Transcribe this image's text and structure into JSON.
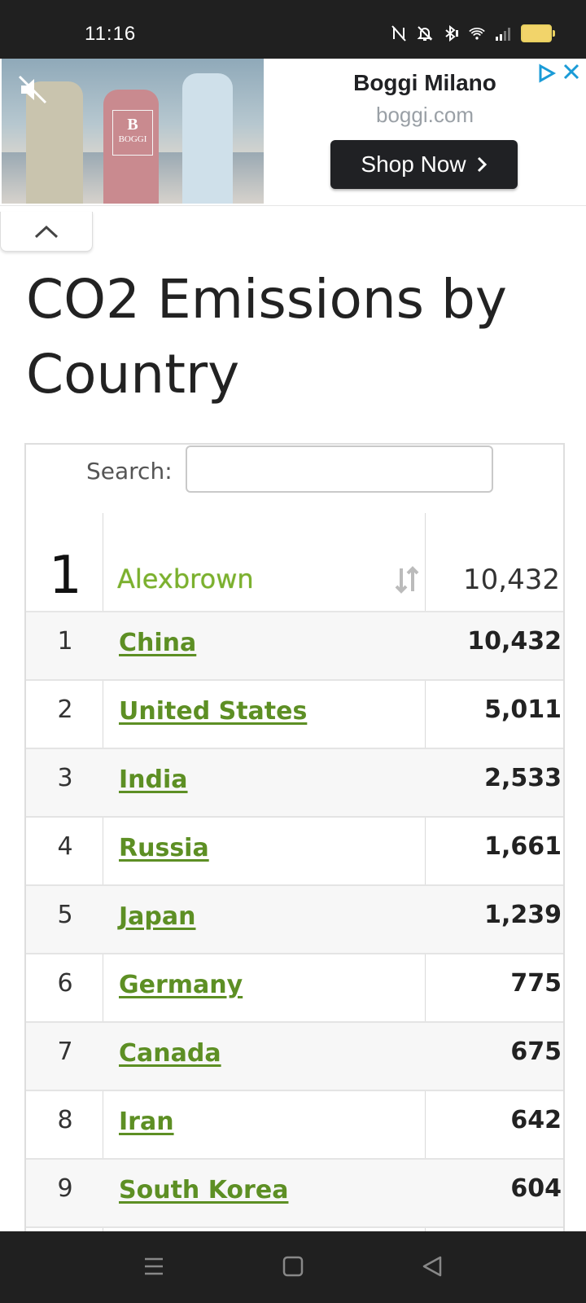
{
  "status_bar": {
    "time": "11:16",
    "icons": [
      "nfc-off-icon",
      "bell-off-icon",
      "bluetooth-icon",
      "wifi-icon",
      "signal-icon",
      "battery-icon"
    ],
    "battery_color": "#f2d46a"
  },
  "ad": {
    "brand_badge_letter": "B",
    "brand_badge_text": "BOGGI",
    "title": "Boggi Milano",
    "url": "boggi.com",
    "cta": "Shop Now",
    "cta_color": "#202124"
  },
  "page": {
    "title": "CO2 Emissions by Country"
  },
  "table": {
    "search_label": "Search:",
    "search_value": "",
    "header": {
      "rank": "1",
      "name": "Alexbrown",
      "value": "10,432",
      "name_color": "#7bb02e"
    },
    "rows": [
      {
        "rank": "1",
        "country": "China",
        "value": "10,432"
      },
      {
        "rank": "2",
        "country": "United States",
        "value": "5,011"
      },
      {
        "rank": "3",
        "country": "India",
        "value": "2,533"
      },
      {
        "rank": "4",
        "country": "Russia",
        "value": "1,661"
      },
      {
        "rank": "5",
        "country": "Japan",
        "value": "1,239"
      },
      {
        "rank": "6",
        "country": "Germany",
        "value": "775"
      },
      {
        "rank": "7",
        "country": "Canada",
        "value": "675"
      },
      {
        "rank": "8",
        "country": "Iran",
        "value": "642"
      },
      {
        "rank": "9",
        "country": "South Korea",
        "value": "604"
      }
    ],
    "link_color": "#5d8f24"
  },
  "nav_bar": {
    "icons": [
      "menu-icon",
      "home-square-icon",
      "back-triangle-icon"
    ]
  }
}
